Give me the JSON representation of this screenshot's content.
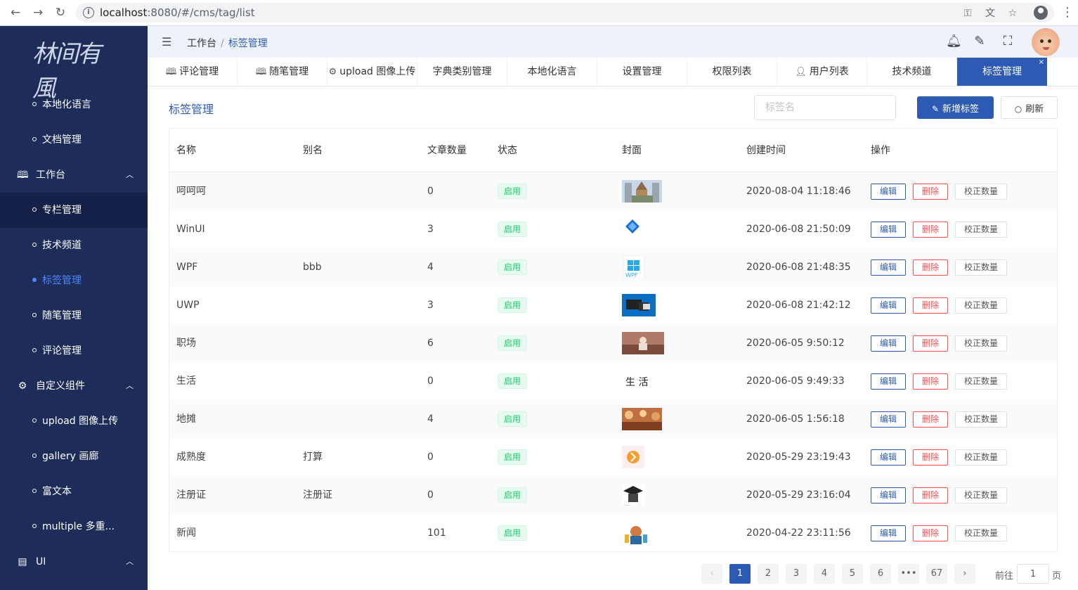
{
  "browser": {
    "url_host": "localhost",
    "url_rest": ":8080/#/cms/tag/list",
    "icons": [
      "back-icon",
      "forward-icon",
      "reload-icon",
      "info-icon",
      "key-icon",
      "translate-icon",
      "star-icon",
      "profile-icon",
      "menu-icon"
    ]
  },
  "sidebar": {
    "logo": "林间有風",
    "items": [
      {
        "type": "sub",
        "label": "本地化语言"
      },
      {
        "type": "sub",
        "label": "文档管理"
      },
      {
        "type": "group",
        "label": "工作台",
        "icon": "book-icon"
      },
      {
        "type": "sub",
        "label": "专栏管理",
        "highlight": true
      },
      {
        "type": "sub",
        "label": "技术频道"
      },
      {
        "type": "sub",
        "label": "标签管理",
        "current": true
      },
      {
        "type": "sub",
        "label": "随笔管理"
      },
      {
        "type": "sub",
        "label": "评论管理"
      },
      {
        "type": "group",
        "label": "自定义组件",
        "icon": "gear-icon"
      },
      {
        "type": "sub",
        "label": "upload 图像上传"
      },
      {
        "type": "sub",
        "label": "gallery 画廊"
      },
      {
        "type": "sub",
        "label": "富文本"
      },
      {
        "type": "sub",
        "label": "multiple 多重..."
      },
      {
        "type": "group",
        "label": "UI",
        "icon": "layout-icon"
      }
    ]
  },
  "header": {
    "breadcrumb": [
      "工作台",
      "标签管理"
    ],
    "icons": [
      "bell-icon",
      "magic-wand-icon",
      "fullscreen-icon"
    ]
  },
  "tabs": [
    {
      "label": "评论管理",
      "icon": "book-icon"
    },
    {
      "label": "随笔管理",
      "icon": "book-icon"
    },
    {
      "label": "upload 图像上传",
      "icon": "gear-icon"
    },
    {
      "label": "字典类别管理"
    },
    {
      "label": "本地化语言"
    },
    {
      "label": "设置管理"
    },
    {
      "label": "权限列表"
    },
    {
      "label": "用户列表",
      "icon": "user-gear-icon"
    },
    {
      "label": "技术频道"
    },
    {
      "label": "标签管理",
      "active": true
    }
  ],
  "main": {
    "title": "标签管理",
    "search_placeholder": "标签名",
    "add_label": "新增标签",
    "refresh_label": "刷新"
  },
  "table": {
    "columns": [
      "名称",
      "别名",
      "文章数量",
      "状态",
      "封面",
      "创建时间",
      "操作"
    ],
    "actions": {
      "edit": "编辑",
      "delete": "删除",
      "fix": "校正数量"
    },
    "rows": [
      {
        "name": "呵呵呵",
        "alias": "",
        "count": "0",
        "status": "启用",
        "created": "2020-08-04 11:18:46",
        "cover": "cover-temple"
      },
      {
        "name": "WinUI",
        "alias": "",
        "count": "3",
        "status": "启用",
        "created": "2020-06-08 21:50:09",
        "cover": "cover-winui"
      },
      {
        "name": "WPF",
        "alias": "bbb",
        "count": "4",
        "status": "启用",
        "created": "2020-06-08 21:48:35",
        "cover": "cover-wpf"
      },
      {
        "name": "UWP",
        "alias": "",
        "count": "3",
        "status": "启用",
        "created": "2020-06-08 21:42:12",
        "cover": "cover-uwp"
      },
      {
        "name": "职场",
        "alias": "",
        "count": "6",
        "status": "启用",
        "created": "2020-06-05 9:50:12",
        "cover": "cover-office"
      },
      {
        "name": "生活",
        "alias": "",
        "count": "0",
        "status": "启用",
        "created": "2020-06-05 9:49:33",
        "cover": "cover-life"
      },
      {
        "name": "地摊",
        "alias": "",
        "count": "4",
        "status": "启用",
        "created": "2020-06-05 1:56:18",
        "cover": "cover-market"
      },
      {
        "name": "成熟度",
        "alias": "打算",
        "count": "0",
        "status": "启用",
        "created": "2020-05-29 23:19:43",
        "cover": "cover-maturity"
      },
      {
        "name": "注册证",
        "alias": "注册证",
        "count": "0",
        "status": "启用",
        "created": "2020-05-29 23:16:04",
        "cover": "cover-cert"
      },
      {
        "name": "新闻",
        "alias": "",
        "count": "101",
        "status": "启用",
        "created": "2020-04-22 23:11:56",
        "cover": "cover-news"
      }
    ]
  },
  "pagination": {
    "prev": "‹",
    "next": "›",
    "pages": [
      "1",
      "2",
      "3",
      "4",
      "5",
      "6",
      "•••",
      "67"
    ],
    "current": "1",
    "goto_prefix": "前往",
    "goto_value": "1",
    "goto_suffix": "页"
  },
  "colors": {
    "sidebar_bg": "#1e2c5a",
    "primary": "#2d5bb4",
    "success": "#13ce66",
    "danger": "#ff4949"
  }
}
